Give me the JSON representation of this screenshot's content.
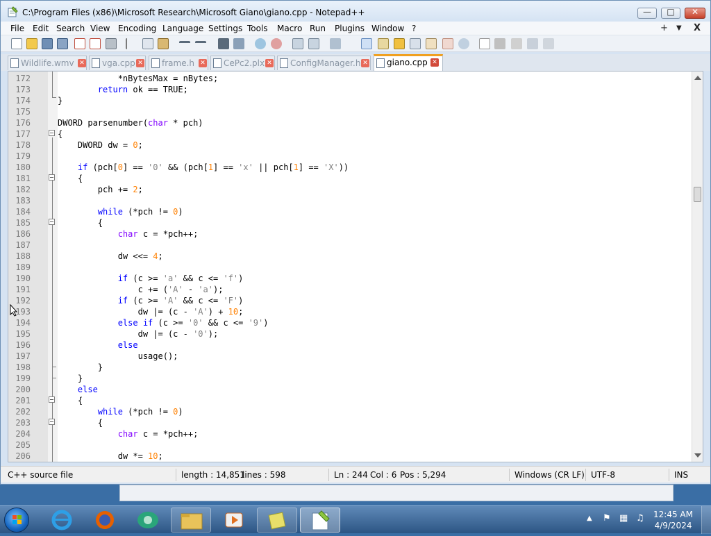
{
  "window": {
    "title": "C:\\Program Files (x86)\\Microsoft Research\\Microsoft Giano\\giano.cpp - Notepad++",
    "controls": {
      "minimize": "—",
      "maximize": "□",
      "close": "✕"
    }
  },
  "menubar": {
    "items": [
      "File",
      "Edit",
      "Search",
      "View",
      "Encoding",
      "Language",
      "Settings",
      "Tools",
      "Macro",
      "Run",
      "Plugins",
      "Window",
      "?"
    ],
    "right": [
      "+",
      "▼",
      "X"
    ]
  },
  "tabs": [
    {
      "label": "Wildlife.wmv",
      "active": false
    },
    {
      "label": "vga.cpp",
      "active": false
    },
    {
      "label": "frame.h",
      "active": false
    },
    {
      "label": "CePc2.plx",
      "active": false
    },
    {
      "label": "ConfigManager.h",
      "active": false
    },
    {
      "label": "giano.cpp",
      "active": true
    }
  ],
  "editor": {
    "lines": [
      {
        "n": "172",
        "html": "            *nBytesMax = nBytes;"
      },
      {
        "n": "173",
        "html": "        <span class='kw'>return</span> ok == TRUE;"
      },
      {
        "n": "174",
        "html": "}"
      },
      {
        "n": "175",
        "html": ""
      },
      {
        "n": "176",
        "html": "DWORD parsenumber(<span class='ty'>char</span> * pch)"
      },
      {
        "n": "177",
        "html": "{"
      },
      {
        "n": "178",
        "html": "    DWORD dw = <span class='num'>0</span>;"
      },
      {
        "n": "179",
        "html": ""
      },
      {
        "n": "180",
        "html": "    <span class='kw'>if</span> (pch[<span class='num'>0</span>] == <span class='str'>'0'</span> && (pch[<span class='num'>1</span>] == <span class='str'>'x'</span> || pch[<span class='num'>1</span>] == <span class='str'>'X'</span>))"
      },
      {
        "n": "181",
        "html": "    {"
      },
      {
        "n": "182",
        "html": "        pch += <span class='num'>2</span>;"
      },
      {
        "n": "183",
        "html": ""
      },
      {
        "n": "184",
        "html": "        <span class='kw'>while</span> (*pch != <span class='num'>0</span>)"
      },
      {
        "n": "185",
        "html": "        {"
      },
      {
        "n": "186",
        "html": "            <span class='ty'>char</span> c = *pch++;"
      },
      {
        "n": "187",
        "html": ""
      },
      {
        "n": "188",
        "html": "            dw <<= <span class='num'>4</span>;"
      },
      {
        "n": "189",
        "html": ""
      },
      {
        "n": "190",
        "html": "            <span class='kw'>if</span> (c >= <span class='str'>'a'</span> && c <= <span class='str'>'f'</span>)"
      },
      {
        "n": "191",
        "html": "                c += (<span class='str'>'A'</span> - <span class='str'>'a'</span>);"
      },
      {
        "n": "192",
        "html": "            <span class='kw'>if</span> (c >= <span class='str'>'A'</span> && c <= <span class='str'>'F'</span>)"
      },
      {
        "n": "193",
        "html": "                dw |= (c - <span class='str'>'A'</span>) + <span class='num'>10</span>;"
      },
      {
        "n": "194",
        "html": "            <span class='kw'>else if</span> (c >= <span class='str'>'0'</span> && c <= <span class='str'>'9'</span>)"
      },
      {
        "n": "195",
        "html": "                dw |= (c - <span class='str'>'0'</span>);"
      },
      {
        "n": "196",
        "html": "            <span class='kw'>else</span>"
      },
      {
        "n": "197",
        "html": "                usage();"
      },
      {
        "n": "198",
        "html": "        }"
      },
      {
        "n": "199",
        "html": "    }"
      },
      {
        "n": "200",
        "html": "    <span class='kw'>else</span>"
      },
      {
        "n": "201",
        "html": "    {"
      },
      {
        "n": "202",
        "html": "        <span class='kw'>while</span> (*pch != <span class='num'>0</span>)"
      },
      {
        "n": "203",
        "html": "        {"
      },
      {
        "n": "204",
        "html": "            <span class='ty'>char</span> c = *pch++;"
      },
      {
        "n": "205",
        "html": ""
      },
      {
        "n": "206",
        "html": "            dw *= <span class='num'>10</span>;"
      }
    ]
  },
  "statusbar": {
    "filetype": "C++ source file",
    "length": "length : 14,851",
    "lines": "lines : 598",
    "ln": "Ln : 244",
    "col": "Col : 6",
    "pos": "Pos : 5,294",
    "eol": "Windows (CR LF)",
    "encoding": "UTF-8",
    "mode": "INS"
  },
  "taskbar": {
    "time": "12:45 AM",
    "date": "4/9/2024"
  }
}
